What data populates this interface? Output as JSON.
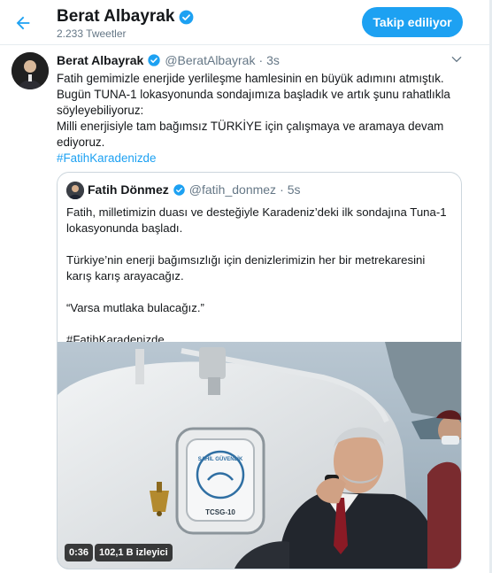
{
  "header": {
    "name": "Berat Albayrak",
    "tweet_count": "2.233 Tweetler",
    "follow_label": "Takip ediliyor"
  },
  "tweet": {
    "name": "Berat Albayrak",
    "handle": "@BeratAlbayrak",
    "separator": "·",
    "time": "3s",
    "lines": [
      "Fatih gemimizle enerjide yerlileşme hamlesinin en büyük adımını atmıştık.",
      "Bugün TUNA-1 lokasyonunda sondajımıza başladık ve artık şunu rahatlıkla",
      "söyleyebiliyoruz:",
      "Milli enerjisiyle tam bağımsız TÜRKİYE için çalışmaya ve aramaya devam",
      "ediyoruz."
    ],
    "hashtag": "#FatihKaradenizde"
  },
  "quote": {
    "name": "Fatih Dönmez",
    "handle": "@fatih_donmez",
    "separator": "·",
    "time": "5s",
    "p1_line1": "Fatih, milletimizin duası ve desteğiyle Karadeniz’deki ilk sondajına Tuna-1",
    "p1_line2": "lokasyonunda başladı.",
    "p2_line1": "Türkiye’nin enerji bağımsızlığı için denizlerimizin her bir metrekaresini",
    "p2_line2": "karış karış arayacağız.",
    "p3": "“Varsa mutlaka bulacağız.”",
    "hashtag": "#FatihKaradenizde",
    "video": {
      "duration": "0:36",
      "views": "102,1 B izleyici",
      "hatch_text": "TCSG-10",
      "emblem_text": "SAHİL GÜVENLİK"
    }
  },
  "colors": {
    "accent": "#1da1f2",
    "muted": "#657786",
    "border": "#e6ecf0",
    "text": "#14171a"
  },
  "icons": {
    "back": "arrow-left-icon",
    "verified": "verified-badge-icon",
    "caret": "chevron-down-icon"
  }
}
